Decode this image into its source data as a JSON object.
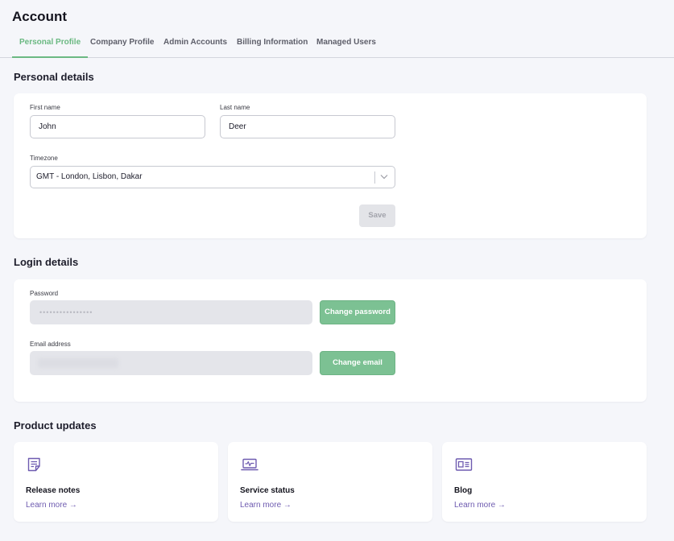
{
  "page": {
    "title": "Account"
  },
  "tabs": [
    {
      "label": "Personal Profile",
      "active": true
    },
    {
      "label": "Company Profile",
      "active": false
    },
    {
      "label": "Admin Accounts",
      "active": false
    },
    {
      "label": "Billing Information",
      "active": false
    },
    {
      "label": "Managed Users",
      "active": false
    }
  ],
  "personal": {
    "title": "Personal details",
    "first_name_label": "First name",
    "first_name_value": "John",
    "last_name_label": "Last name",
    "last_name_value": "Deer",
    "timezone_label": "Timezone",
    "timezone_value": "GMT - London, Lisbon, Dakar",
    "save_label": "Save"
  },
  "login": {
    "title": "Login details",
    "password_label": "Password",
    "password_masked": "••••••••••••••••",
    "change_password_label": "Change password",
    "email_label": "Email address",
    "change_email_label": "Change email"
  },
  "updates": {
    "title": "Product updates",
    "cards": [
      {
        "title": "Release notes",
        "link": "Learn more",
        "icon": "document-icon"
      },
      {
        "title": "Service status",
        "link": "Learn more",
        "icon": "laptop-pulse-icon"
      },
      {
        "title": "Blog",
        "link": "Learn more",
        "icon": "newspaper-icon"
      }
    ],
    "arrow": "→"
  },
  "colors": {
    "accent": "#6bb982",
    "link": "#6e5bb0",
    "background": "#f5f6fa"
  }
}
